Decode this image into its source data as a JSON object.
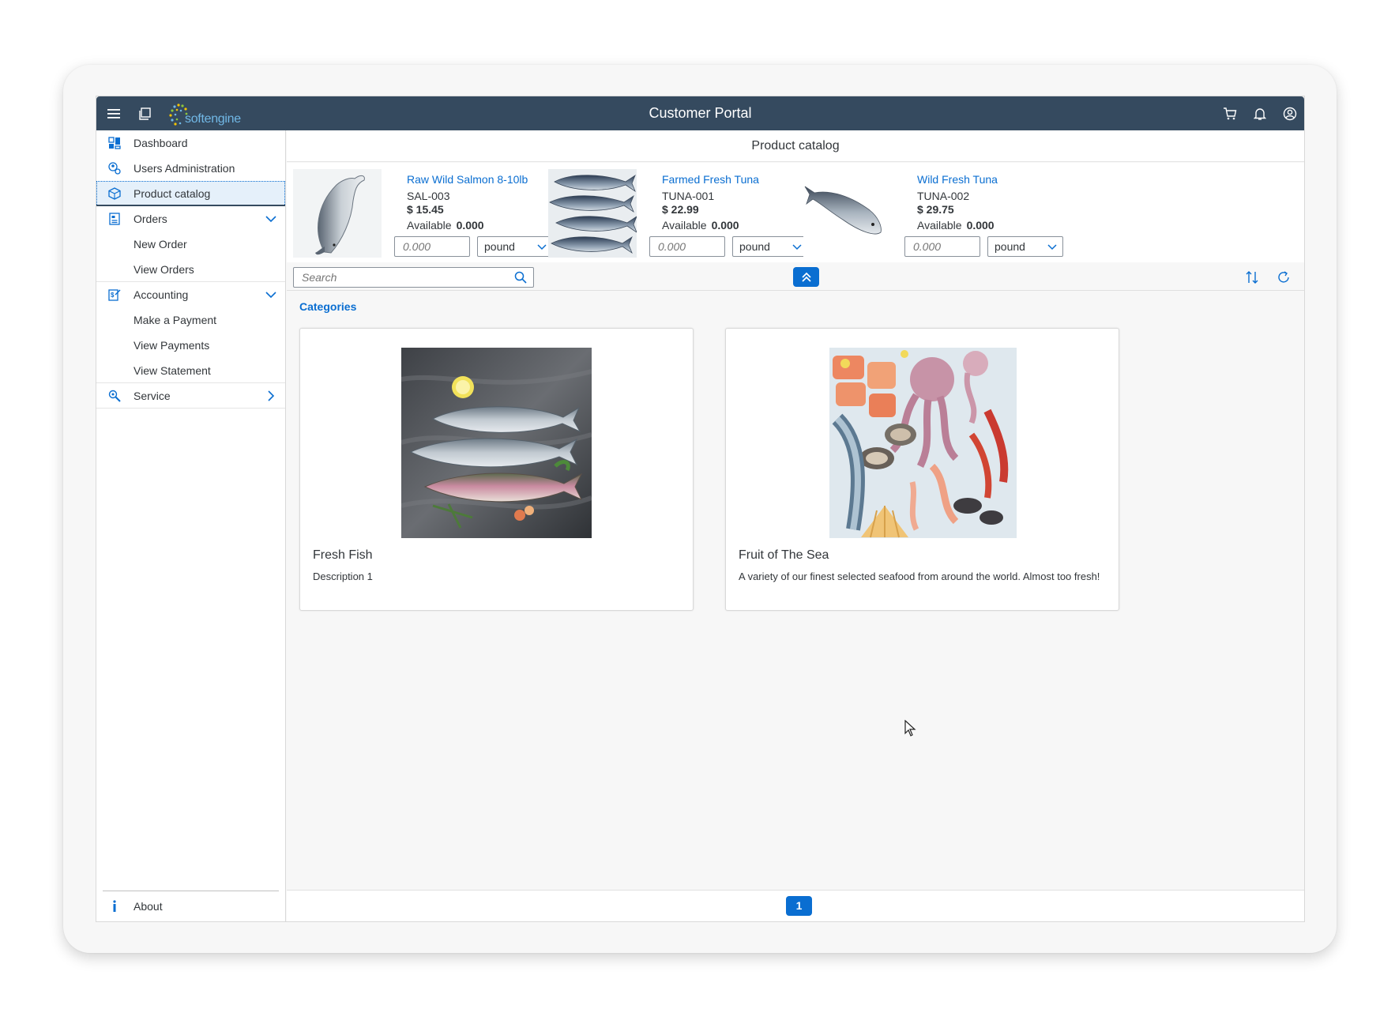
{
  "shell": {
    "title": "Customer Portal",
    "logo_text": "softengine"
  },
  "sidebar": {
    "items": [
      {
        "label": "Dashboard",
        "icon": "dashboard-icon"
      },
      {
        "label": "Users Administration",
        "icon": "users-admin-icon"
      },
      {
        "label": "Product catalog",
        "icon": "product-icon"
      },
      {
        "label": "Orders",
        "icon": "orders-icon"
      },
      {
        "label": "New Order"
      },
      {
        "label": "View Orders"
      },
      {
        "label": "Accounting",
        "icon": "accounting-icon"
      },
      {
        "label": "Make a Payment"
      },
      {
        "label": "View Payments"
      },
      {
        "label": "View Statement"
      },
      {
        "label": "Service",
        "icon": "service-icon"
      }
    ],
    "footer": {
      "label": "About",
      "icon": "info-icon"
    }
  },
  "main": {
    "page_title": "Product catalog",
    "products": [
      {
        "name": "Raw Wild Salmon 8-10lb",
        "code": "SAL-003",
        "price": "$ 15.45",
        "available_label": "Available",
        "available": "0.000",
        "qty_placeholder": "0.000",
        "unit": "pound"
      },
      {
        "name": "Farmed Fresh Tuna",
        "code": "TUNA-001",
        "price": "$ 22.99",
        "available_label": "Available",
        "available": "0.000",
        "qty_placeholder": "0.000",
        "unit": "pound"
      },
      {
        "name": "Wild Fresh Tuna",
        "code": "TUNA-002",
        "price": "$ 29.75",
        "available_label": "Available",
        "available": "0.000",
        "qty_placeholder": "0.000",
        "unit": "pound"
      }
    ],
    "search": {
      "placeholder": "Search"
    },
    "section_title": "Categories",
    "categories": [
      {
        "title": "Fresh Fish",
        "description": "Description 1"
      },
      {
        "title": "Fruit of The Sea",
        "description": "A variety of our finest selected seafood from around the world. Almost too fresh!"
      }
    ],
    "pager": {
      "current_page": "1"
    }
  },
  "colors": {
    "shell_bg": "#354a5f",
    "accent": "#0a6ed1",
    "page_bg": "#f7f7f7"
  }
}
